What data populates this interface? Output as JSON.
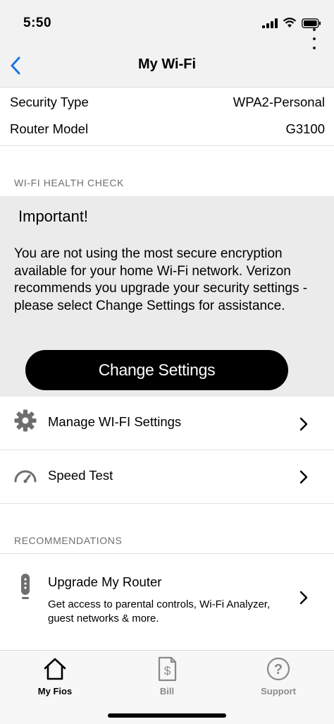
{
  "status_bar": {
    "time": "5:50"
  },
  "header": {
    "title": "My Wi-Fi"
  },
  "network_info": [
    {
      "label": "Security Type",
      "value": "WPA2-Personal"
    },
    {
      "label": "Router Model",
      "value": "G3100"
    }
  ],
  "health_check": {
    "section_title": "WI-FI HEALTH CHECK",
    "alert_title": "Important!",
    "alert_body": "You are not using the most secure encryption available for your home Wi-Fi network. Verizon recommends you upgrade your security settings - please select Change Settings for assistance.",
    "button_label": "Change Settings"
  },
  "menu": [
    {
      "label": "Manage WI-FI Settings",
      "icon": "gear-icon"
    },
    {
      "label": "Speed Test",
      "icon": "speedometer-icon"
    }
  ],
  "recommendations": {
    "section_title": "RECOMMENDATIONS",
    "items": [
      {
        "title": "Upgrade My Router",
        "description": "Get access to parental controls, Wi-Fi Analyzer, guest networks & more.",
        "icon": "router-icon"
      }
    ]
  },
  "tab_bar": {
    "tabs": [
      {
        "label": "My Fios",
        "icon": "home-icon",
        "active": true
      },
      {
        "label": "Bill",
        "icon": "bill-icon",
        "active": false
      },
      {
        "label": "Support",
        "icon": "help-icon",
        "active": false
      }
    ],
    "colors": {
      "active": "#000000",
      "inactive": "#8a8a8a"
    }
  }
}
